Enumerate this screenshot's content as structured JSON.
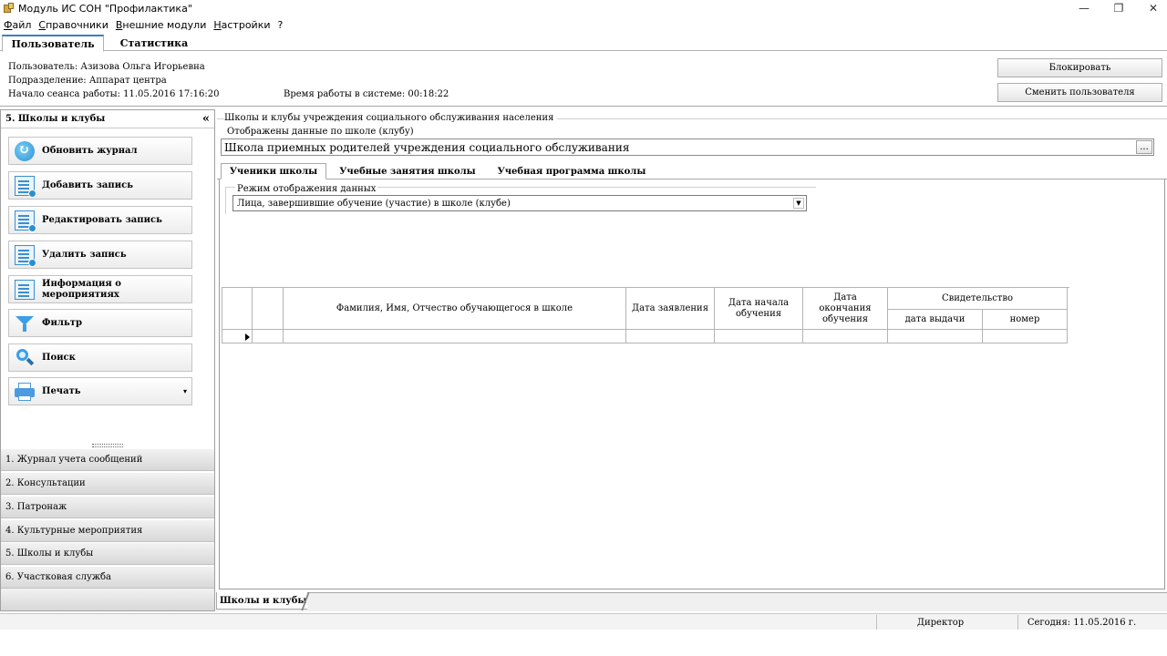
{
  "window": {
    "title": "Модуль ИС СОН \"Профилактика\"",
    "controls": {
      "minimize": "—",
      "maximize": "❐",
      "close": "✕"
    }
  },
  "menu": [
    "Файл",
    "Справочники",
    "Внешние модули",
    "Настройки",
    "?"
  ],
  "top_tabs": {
    "user": "Пользователь",
    "stats": "Статистика"
  },
  "user_info": {
    "user": "Пользователь: Азизова Ольга Игорьевна",
    "department": "Подразделение: Аппарат центра",
    "session_start": "Начало сеанса работы: 11.05.2016 17:16:20",
    "elapsed": "Время работы в системе: 00:18:22",
    "lock_button": "Блокировать",
    "switch_user_button": "Сменить пользователя"
  },
  "left_panel": {
    "header": "5. Школы и клубы",
    "collapse_glyph": "«",
    "actions": [
      {
        "label": "Обновить журнал",
        "icon": "refresh-icon"
      },
      {
        "label": "Добавить запись",
        "icon": "add-record-icon"
      },
      {
        "label": "Редактировать запись",
        "icon": "edit-record-icon"
      },
      {
        "label": "Удалить запись",
        "icon": "delete-record-icon"
      },
      {
        "label": "Информация о мероприятиях",
        "icon": "info-icon"
      },
      {
        "label": "Фильтр",
        "icon": "filter-icon"
      },
      {
        "label": "Поиск",
        "icon": "search-icon"
      },
      {
        "label": "Печать",
        "icon": "printer-icon"
      }
    ],
    "print_dropdown": "▾",
    "nav": [
      "1. Журнал учета сообщений",
      "2. Консультации",
      "3. Патронаж",
      "4. Культурные мероприятия",
      "5. Школы и клубы",
      "6. Участковая служба"
    ]
  },
  "main": {
    "group_title": "Школы и клубы учреждения социального обслуживания населения",
    "school_caption": "Отображены данные по школе (клубу)",
    "school_value": "Школа приемных родителей учреждения социального обслуживания",
    "browse_label": "...",
    "tabs": [
      "Ученики школы",
      "Учебные занятия школы",
      "Учебная программа школы"
    ],
    "mode_label": "Режим отображения данных",
    "mode_value": "Лица, завершившие обучение (участие) в школе (клубе)",
    "mode_arrow": "▼",
    "grid": {
      "col_name": "Фамилия, Имя, Отчество обучающегося в школе",
      "col_application_date": "Дата заявления",
      "col_start_date": "Дата начала обучения",
      "col_end_date": "Дата окончания обучения",
      "col_certificate": "Свидетельство",
      "col_issue_date": "дата выдачи",
      "col_number": "номер"
    }
  },
  "doc_tab": "Школы и клубы",
  "status": {
    "role": "Директор",
    "today": "Сегодня: 11.05.2016 г."
  }
}
